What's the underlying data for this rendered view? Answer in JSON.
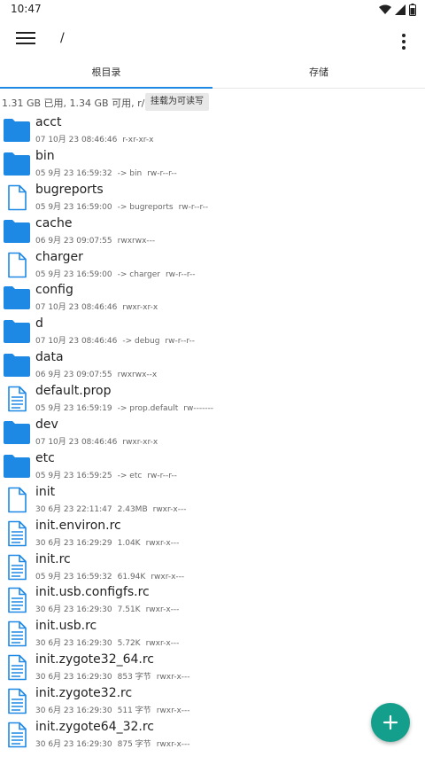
{
  "status": {
    "time": "10:47"
  },
  "appbar": {
    "path": "/"
  },
  "tabs": [
    {
      "label": "根目录"
    },
    {
      "label": "存储"
    }
  ],
  "storage": {
    "info": "1.31 GB 已用, 1.34 GB 可用, r/o",
    "remount_label": "挂载为可读写"
  },
  "files": [
    {
      "name": "acct",
      "kind": "folder",
      "date": "07 10月 23 08:46:46",
      "detail": "",
      "perm": "r-xr-xr-x"
    },
    {
      "name": "bin",
      "kind": "folder",
      "date": "05 9月 23 16:59:32",
      "detail": "-> bin",
      "perm": "rw-r--r--"
    },
    {
      "name": "bugreports",
      "kind": "file",
      "date": "05 9月 23 16:59:00",
      "detail": "-> bugreports",
      "perm": "rw-r--r--"
    },
    {
      "name": "cache",
      "kind": "folder",
      "date": "06 9月 23 09:07:55",
      "detail": "",
      "perm": "rwxrwx---"
    },
    {
      "name": "charger",
      "kind": "file",
      "date": "05 9月 23 16:59:00",
      "detail": "-> charger",
      "perm": "rw-r--r--"
    },
    {
      "name": "config",
      "kind": "folder",
      "date": "07 10月 23 08:46:46",
      "detail": "",
      "perm": "rwxr-xr-x"
    },
    {
      "name": "d",
      "kind": "folder",
      "date": "07 10月 23 08:46:46",
      "detail": "-> debug",
      "perm": "rw-r--r--"
    },
    {
      "name": "data",
      "kind": "folder",
      "date": "06 9月 23 09:07:55",
      "detail": "",
      "perm": "rwxrwx--x"
    },
    {
      "name": "default.prop",
      "kind": "text",
      "date": "05 9月 23 16:59:19",
      "detail": "-> prop.default",
      "perm": "rw-------"
    },
    {
      "name": "dev",
      "kind": "folder",
      "date": "07 10月 23 08:46:46",
      "detail": "",
      "perm": "rwxr-xr-x"
    },
    {
      "name": "etc",
      "kind": "folder",
      "date": "05 9月 23 16:59:25",
      "detail": "-> etc",
      "perm": "rw-r--r--"
    },
    {
      "name": "init",
      "kind": "file",
      "date": "30 6月 23 22:11:47",
      "detail": "2.43MB",
      "perm": "rwxr-x---"
    },
    {
      "name": "init.environ.rc",
      "kind": "text",
      "date": "30 6月 23 16:29:29",
      "detail": "1.04K",
      "perm": "rwxr-x---"
    },
    {
      "name": "init.rc",
      "kind": "text",
      "date": "05 9月 23 16:59:32",
      "detail": "61.94K",
      "perm": "rwxr-x---"
    },
    {
      "name": "init.usb.configfs.rc",
      "kind": "text",
      "date": "30 6月 23 16:29:30",
      "detail": "7.51K",
      "perm": "rwxr-x---"
    },
    {
      "name": "init.usb.rc",
      "kind": "text",
      "date": "30 6月 23 16:29:30",
      "detail": "5.72K",
      "perm": "rwxr-x---"
    },
    {
      "name": "init.zygote32_64.rc",
      "kind": "text",
      "date": "30 6月 23 16:29:30",
      "detail": "853 字节",
      "perm": "rwxr-x---"
    },
    {
      "name": "init.zygote32.rc",
      "kind": "text",
      "date": "30 6月 23 16:29:30",
      "detail": "511 字节",
      "perm": "rwxr-x---"
    },
    {
      "name": "init.zygote64_32.rc",
      "kind": "text",
      "date": "30 6月 23 16:29:30",
      "detail": "875 字节",
      "perm": "rwxr-x---"
    }
  ],
  "colors": {
    "folder": "#1e88e5",
    "accent": "#1e88e5",
    "fab": "#139f8b"
  }
}
